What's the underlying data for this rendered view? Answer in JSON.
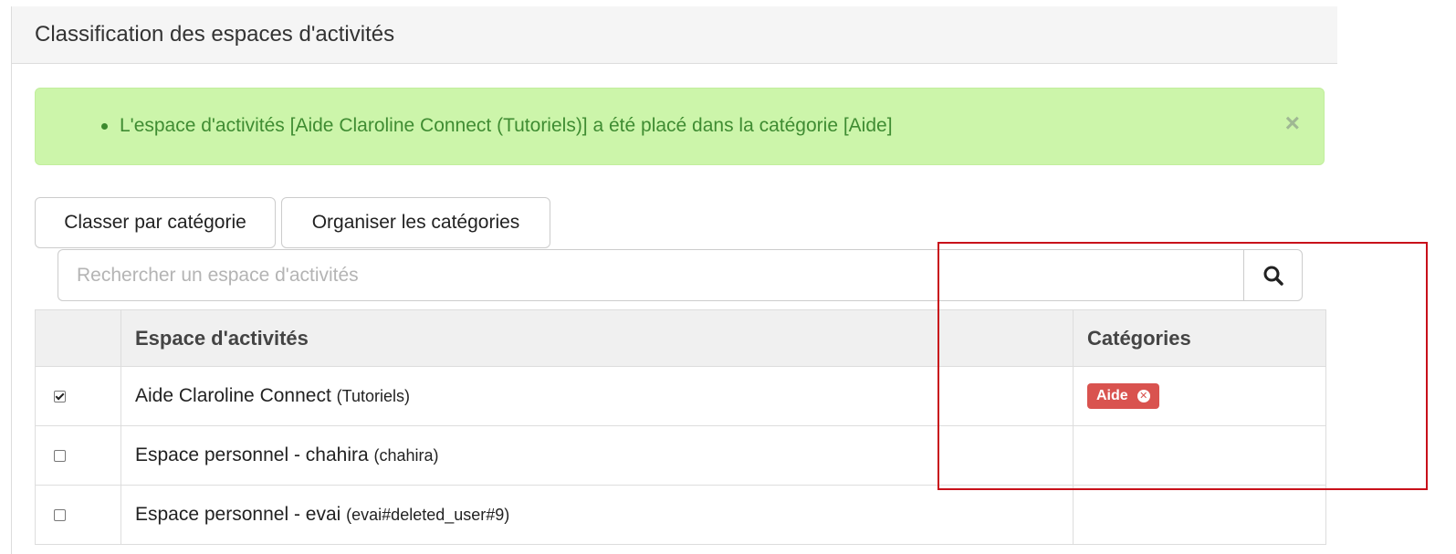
{
  "panel": {
    "title": "Classification des espaces d'activités"
  },
  "alert": {
    "message": "L'espace d'activités [Aide Claroline Connect (Tutoriels)] a été placé dans la catégorie [Aide]",
    "close": "×"
  },
  "buttons": {
    "classer": "Classer par catégorie",
    "organiser": "Organiser les catégories"
  },
  "search": {
    "placeholder": "Rechercher un espace d'activités",
    "icon": "search-icon"
  },
  "table": {
    "headers": {
      "check": "",
      "workspace": "Espace d'activités",
      "categories": "Catégories"
    },
    "rows": [
      {
        "checked": true,
        "name": "Aide Claroline Connect",
        "code": "(Tutoriels)",
        "category": "Aide"
      },
      {
        "checked": false,
        "name": "Espace personnel - chahira",
        "code": "(chahira)",
        "category": ""
      },
      {
        "checked": false,
        "name": "Espace personnel - evai",
        "code": "(evai#deleted_user#9)",
        "category": ""
      }
    ]
  },
  "colors": {
    "alert_bg": "#ccf5aa",
    "alert_text": "#3f8c32",
    "badge": "#d9534f",
    "highlight": "#c8101a"
  }
}
